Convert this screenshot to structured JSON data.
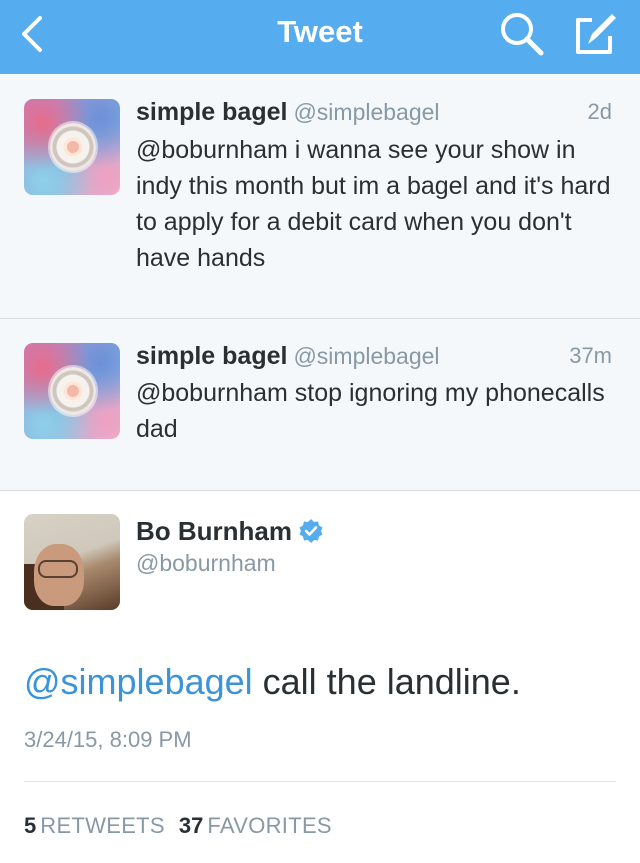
{
  "nav": {
    "title": "Tweet",
    "icons": {
      "back": "chevron-left-icon",
      "search": "search-icon",
      "compose": "compose-icon"
    },
    "background": "#55acee"
  },
  "replies": [
    {
      "display_name": "simple bagel",
      "handle": "@simplebagel",
      "time": "2d",
      "text": "@boburnham i wanna see your show in indy this month but im a bagel and it's hard to apply for a debit card when you don't have hands"
    },
    {
      "display_name": "simple bagel",
      "handle": "@simplebagel",
      "time": "37m",
      "text": "@boburnham stop ignoring my phonecalls dad"
    }
  ],
  "main_tweet": {
    "display_name": "Bo Burnham",
    "handle": "@boburnham",
    "verified": true,
    "mention": "@simplebagel",
    "text": " call the landline.",
    "date": "3/24/15, 8:09 PM",
    "retweets_count": "5",
    "retweets_label": "RETWEETS",
    "favorites_count": "37",
    "favorites_label": "FAVORITES"
  },
  "colors": {
    "accent": "#55acee",
    "link": "#3b94d9",
    "muted": "#8899a6",
    "text": "#292f33",
    "reply_bg": "#f5f8fa"
  }
}
